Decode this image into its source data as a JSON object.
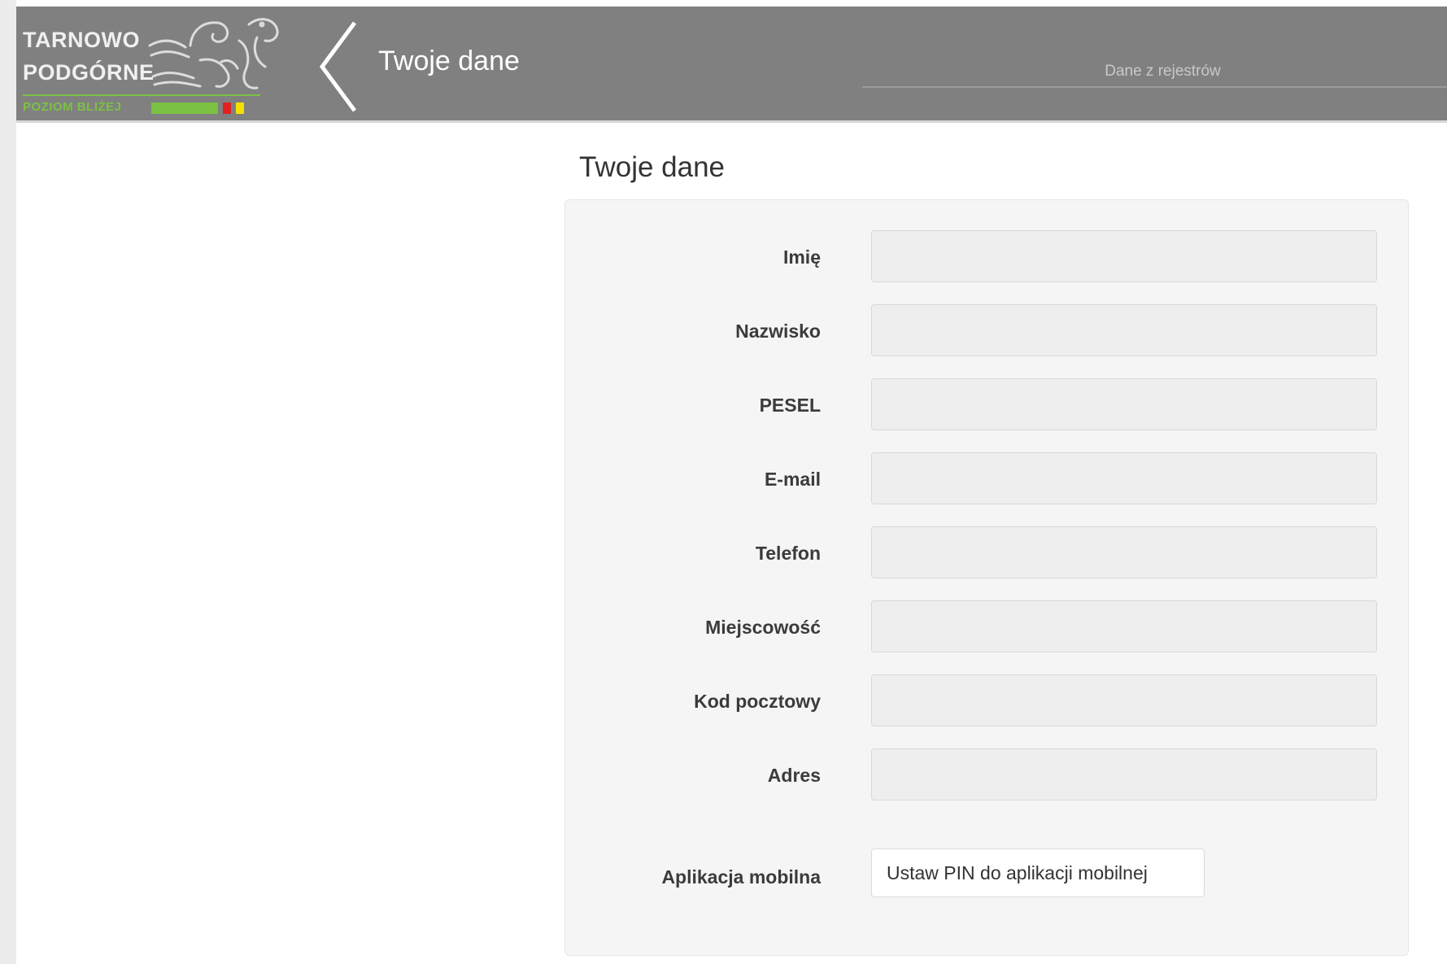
{
  "header": {
    "logo": {
      "line1": "TARNOWO",
      "line2": "PODGÓRNE",
      "tagline": "POZIOM BLIŻEJ",
      "bar_colors": [
        "#7bc143",
        "#e22020",
        "#f5e000"
      ]
    },
    "back_icon": "chevron-left-icon",
    "title": "Twoje dane",
    "registry_tab": "Dane z rejestrów",
    "background_color": "#808080"
  },
  "main": {
    "section_title": "Twoje dane",
    "fields": [
      {
        "label": "Imię",
        "value": "",
        "placeholder": ""
      },
      {
        "label": "Nazwisko",
        "value": "",
        "placeholder": ""
      },
      {
        "label": "PESEL",
        "value": "",
        "placeholder": ""
      },
      {
        "label": "E-mail",
        "value": "",
        "placeholder": ""
      },
      {
        "label": "Telefon",
        "value": "",
        "placeholder": ""
      },
      {
        "label": "Miejscowość",
        "value": "",
        "placeholder": ""
      },
      {
        "label": "Kod pocztowy",
        "value": "",
        "placeholder": ""
      },
      {
        "label": "Adres",
        "value": "",
        "placeholder": ""
      }
    ],
    "mobile": {
      "label": "Aplikacja mobilna",
      "button_label": "Ustaw PIN do aplikacji mobilnej"
    }
  }
}
